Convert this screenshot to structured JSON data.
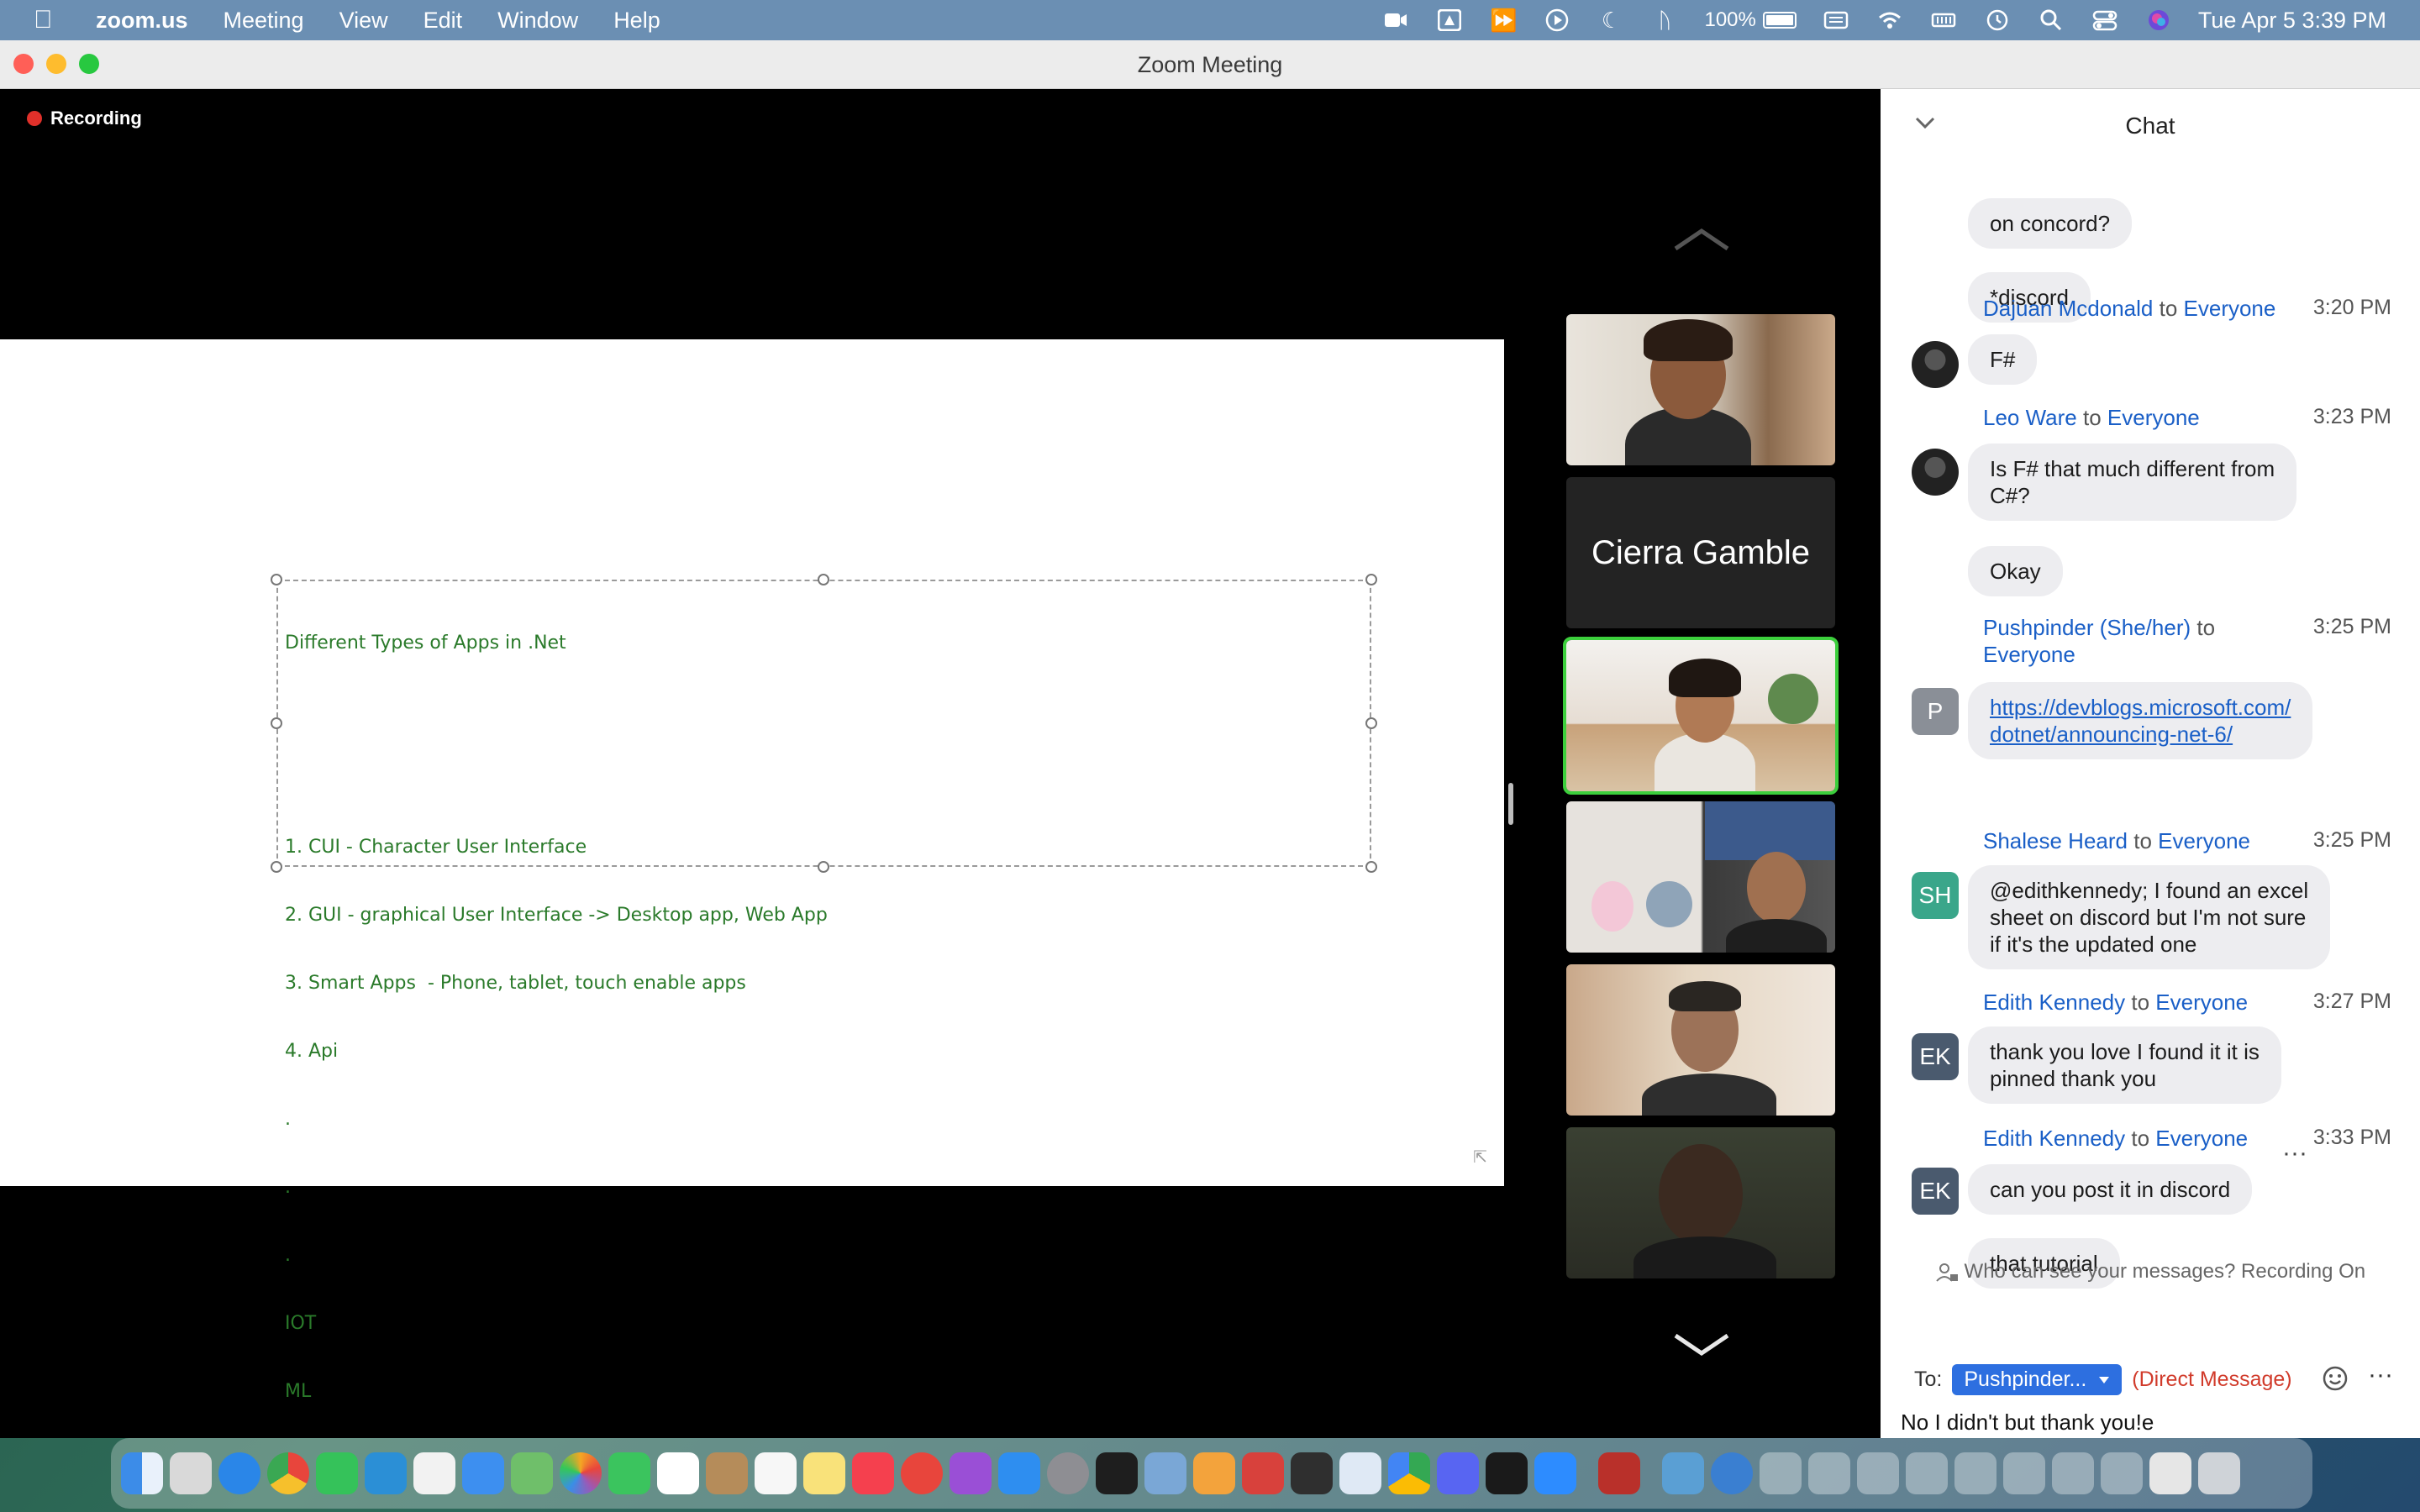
{
  "menubar": {
    "app_name": "zoom.us",
    "menus": [
      "Meeting",
      "View",
      "Edit",
      "Window",
      "Help"
    ],
    "battery": "100%",
    "clock": "Tue Apr 5  3:39 PM"
  },
  "window": {
    "title": "Zoom Meeting"
  },
  "meeting": {
    "recording_label": "Recording",
    "shared_text": [
      "Different Types of Apps in .Net",
      "",
      "",
      "1. CUI - Character User Interface",
      "2. GUI - graphical User Interface -> Desktop app, Web App",
      "3. Smart Apps  - Phone, tablet, touch enable apps",
      "4. Api",
      ".",
      ".",
      ".",
      "IOT",
      "ML"
    ],
    "name_tile": "Cierra Gamble"
  },
  "chat": {
    "title": "Chat",
    "messages": [
      {
        "text": "on concord?"
      },
      {
        "text": "*discord"
      },
      {
        "sender": "Dajuan Mcdonald",
        "to": "to",
        "recipient": "Everyone",
        "time": "3:20 PM",
        "text": "F#"
      },
      {
        "sender": "Leo Ware",
        "to": "to",
        "recipient": "Everyone",
        "time": "3:23 PM",
        "text_lines": [
          "Is F# that much different from",
          "C#?"
        ]
      },
      {
        "text": "Okay"
      },
      {
        "sender": "Pushpinder (She/her)",
        "to": "to",
        "recipient": "Everyone",
        "time": "3:25 PM",
        "avatar": "P",
        "text_lines": [
          "https://devblogs.microsoft.com/",
          "dotnet/announcing-net-6/"
        ]
      },
      {
        "sender": "Shalese Heard",
        "to": "to",
        "recipient": "Everyone",
        "time": "3:25 PM",
        "avatar": "SH",
        "text_lines": [
          "@edithkennedy; I found an excel",
          "sheet on discord but I'm not sure",
          "if it's the updated one"
        ]
      },
      {
        "sender": "Edith Kennedy",
        "to": "to",
        "recipient": "Everyone",
        "time": "3:27 PM",
        "avatar": "EK",
        "text_lines": [
          "thank you love I found it it is",
          "pinned thank you"
        ]
      },
      {
        "sender": "Edith Kennedy",
        "to": "to",
        "recipient": "Everyone",
        "time": "3:33 PM",
        "avatar": "EK",
        "text": "can you post it in discord"
      },
      {
        "text": "that tutorial"
      }
    ],
    "more_glyph": "···",
    "visibility_note": "Who can see your messages? Recording On",
    "to_label": "To:",
    "to_value": "Pushpinder...",
    "dm_label": "(Direct Message)",
    "input_value": "No I didn't but thank you!e"
  },
  "colors": {
    "accent": "#2d6fe0",
    "link": "#1a5fc7",
    "recording": "#e0302a",
    "active_speaker": "#3ccf3c",
    "shared_text": "#2a7a2a"
  },
  "icons": [
    "apple-icon",
    "camera-icon",
    "wifi-icon",
    "battery-icon",
    "search-icon",
    "chevron-up-icon",
    "chevron-down-icon",
    "emoji-icon",
    "person-lock-icon"
  ]
}
